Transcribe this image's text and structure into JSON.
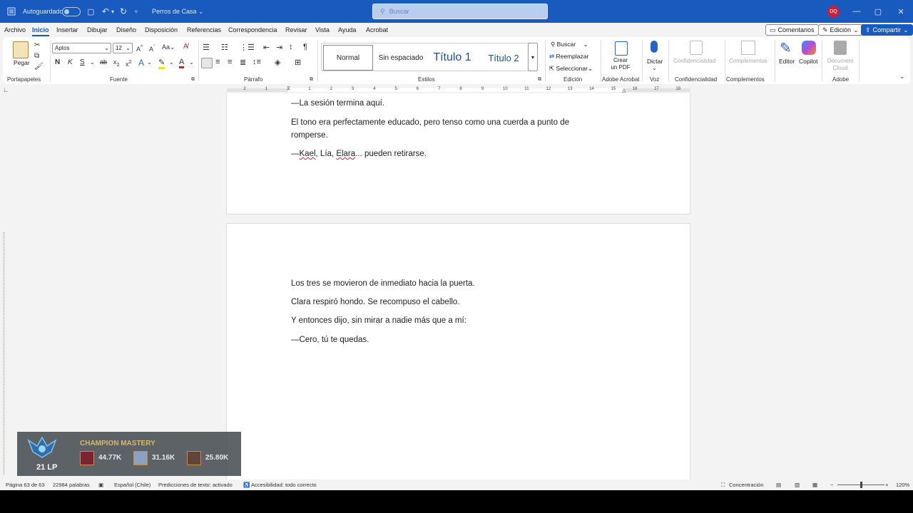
{
  "titlebar": {
    "autosave": "Autoguardado",
    "doc_title": "Perros de Casa",
    "search_placeholder": "Buscar",
    "avatar_initials": "DQ"
  },
  "menu": {
    "tabs": [
      "Archivo",
      "Inicio",
      "Insertar",
      "Dibujar",
      "Diseño",
      "Disposición",
      "Referencias",
      "Correspondencia",
      "Revisar",
      "Vista",
      "Ayuda",
      "Acrobat"
    ],
    "active_tab": "Inicio",
    "comments": "Comentarios",
    "editing": "Edición",
    "share": "Compartir"
  },
  "ribbon": {
    "paste": "Pegar",
    "font_name": "Aptos",
    "font_size": "12",
    "styles": [
      "Normal",
      "Sin espaciado",
      "Título 1",
      "Título 2"
    ],
    "find": "Buscar",
    "replace": "Reemplazar",
    "select": "Seleccionar",
    "create_pdf_line1": "Crear",
    "create_pdf_line2": "un PDF",
    "dictate": "Dictar",
    "sensitivity": "Confidencialidad",
    "addins": "Complementos",
    "editor": "Editor",
    "copilot": "Copilot",
    "doc_cloud_line1": "Document",
    "doc_cloud_line2": "Cloud",
    "groups": {
      "clipboard": "Portapapeles",
      "font": "Fuente",
      "paragraph": "Párrafo",
      "styles": "Estilos",
      "editing": "Edición",
      "acrobat": "Adobe Acrobat",
      "voice": "Voz",
      "sensitivity": "Confidencialidad",
      "addins": "Complementos",
      "adobe": "Adobe"
    }
  },
  "ruler_ticks": [
    "2",
    "1",
    "1",
    "2",
    "3",
    "4",
    "5",
    "6",
    "7",
    "8",
    "9",
    "10",
    "11",
    "12",
    "13",
    "14",
    "15",
    "16",
    "17",
    "18"
  ],
  "page1": {
    "line1": "—La sesión termina aquí.",
    "line2a": "El tono era perfectamente educado, pero tenso como una cuerda a punto de",
    "line2b": "romperse.",
    "line3_dash": "—",
    "line3_kael": "Kael",
    "line3_mid": ", Lía, ",
    "line3_elara": "Elara",
    "line3_end": "... pueden retirarse."
  },
  "page2": {
    "line1": "Los tres se movieron de inmediato hacia la puerta.",
    "line2": "Clara respiró hondo. Se recompuso el cabello.",
    "line3": "Y entonces dijo, sin mirar a nadie más que a mí:",
    "line4": "—Cero, tú te quedas."
  },
  "overlay": {
    "title": "CHAMPION MASTERY",
    "lp": "21 LP",
    "points": [
      "44.77K",
      "31.16K",
      "25.80K"
    ]
  },
  "status": {
    "page": "Página 63 de 63",
    "words": "22984 palabras",
    "language": "Español (Chile)",
    "predictions": "Predicciones de texto: activado",
    "accessibility": "Accesibilidad: todo correcto",
    "focus": "Concentración",
    "zoom": "120%"
  },
  "colors": {
    "accent": "#185abd",
    "squiggle": "#d62020",
    "mastery_gold": "#d9b76a"
  }
}
